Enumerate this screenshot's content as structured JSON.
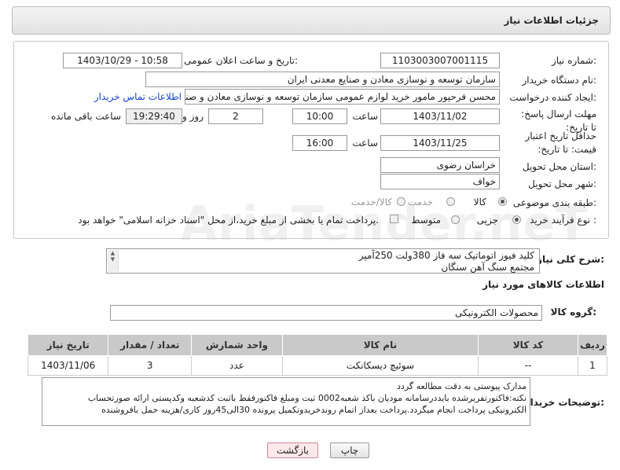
{
  "header": {
    "title": "جزئیات اطلاعات نیاز"
  },
  "form": {
    "need_number_label": "شماره نیاز:",
    "need_number": "1103003007001115",
    "announce_label": "تاریخ و ساعت اعلان عمومی:",
    "announce_value": "1403/10/29 - 10:58",
    "buyer_org_label": "نام دستگاه خریدار:",
    "buyer_org": "سازمان توسعه و نوسازی معادن و صنایع معدنی ایران",
    "creator_label": "ایجاد کننده درخواست:",
    "creator": "محسن فرحپور مامور خرید لوازم عمومی سازمان توسعه و نوسازی معادن و صنایع معدنی ایران",
    "contact_link": "اطلاعات تماس خریدار",
    "reply_deadline_label": "مهلت ارسال پاسخ: تا تاریخ:",
    "reply_date": "1403/11/02",
    "time_label": "ساعت",
    "reply_time": "10:00",
    "days_value": "2",
    "days_label": "روز و",
    "remaining_time": "19:29:40",
    "remaining_label": "ساعت باقی مانده",
    "price_validity_label": "حداقل تاریخ اعتبار قیمت: تا تاریخ:",
    "price_date": "1403/11/25",
    "price_time": "16:00",
    "province_label": "استان محل تحویل:",
    "province": "خراسان رضوی",
    "city_label": "شهر محل تحویل:",
    "city": "خواف",
    "category_label": "طبقه بندی موضوعی:",
    "category_options": [
      "کالا",
      "خدمت",
      "کالا/خدمت"
    ],
    "purchase_type_label": "نوع فرآیند خرید :",
    "purchase_options": [
      "جزیی",
      "متوسط"
    ],
    "payment_note": "پرداخت تمام یا بخشی از مبلغ خرید،از محل \"اسناد خزانه اسلامی\" خواهد بود."
  },
  "description": {
    "label": "شرح کلی نیاز:",
    "lines": [
      "کلید فیوز اتوماتیک سه فاز 380ولت 250آمپر",
      "مجتمع سنگ آهن سنگان"
    ]
  },
  "goods": {
    "section_title": "اطلاعات کالاهای مورد نیاز",
    "group_label": "گروه کالا:",
    "group_value": "محصولات الکترونیکی",
    "columns": [
      "ردیف",
      "کد کالا",
      "نام کالا",
      "واحد شمارش",
      "تعداد / مقدار",
      "تاریخ نیاز"
    ],
    "rows": [
      [
        "1",
        "--",
        "سوئیچ دیسکانکت",
        "عدد",
        "3",
        "1403/11/06"
      ]
    ]
  },
  "buyer_notes": {
    "label": "توضیحات خریدار:",
    "lines": [
      "مدارک پیوستی به دقت مطالعه گردد",
      "نکته:فاکتورتفریرشده بایددرسامانه مودیان باکد شعبه0002 ثبت ومبلغ فاکتورفقط باثبت کدشعبه وکدپستی ارائه صورتحساب",
      "الکترونیکی پرداخت انجام میگردد.پرداخت بعداز اتمام روندخریدوتکمیل پرونده 30الی45روز کاری/هزینه حمل بافروشنده"
    ]
  },
  "buttons": {
    "print": "چاپ",
    "back": "بازگشت"
  },
  "watermark": "AriaTender.neT"
}
